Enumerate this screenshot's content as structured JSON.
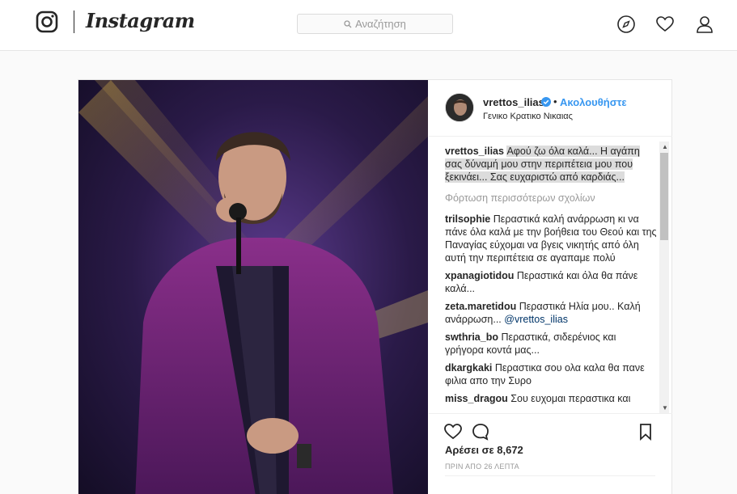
{
  "header": {
    "wordmark": "Instagram",
    "search_placeholder": "Αναζήτηση",
    "icons": [
      "instagram-logo-icon",
      "search-icon",
      "explore-compass-icon",
      "heart-icon",
      "profile-icon"
    ]
  },
  "post": {
    "username": "vrettos_ilias",
    "verified": true,
    "follow_label": "Ακολουθήστε",
    "separator": "•",
    "location": "Γενικο Κρατικο Νικαιας",
    "caption": {
      "user": "vrettos_ilias",
      "text": "Αφού ζω όλα καλά... Η αγάπη σας δύναμή μου στην περιπέτεια μου που ξεκινάει... Σας ευχαριστώ από καρδιάς..."
    },
    "load_more": "Φόρτωση περισσότερων σχολίων",
    "comments": [
      {
        "user": "trilsophie",
        "text": "Περαστικά καλή ανάρρωση κι να πάνε όλα καλά με την βοήθεια του Θεού και της Παναγίας εύχομαι να βγεις νικητής από όλη αυτή την περιπέτεια σε αγαπαμε πολύ"
      },
      {
        "user": "xpanagiotidou",
        "text": "Περαστικά και όλα θα πάνε καλά..."
      },
      {
        "user": "zeta.maretidou",
        "text": "Περαστικά Ηλία μου.. Καλή ανάρρωση...",
        "mention": "@vrettos_ilias"
      },
      {
        "user": "swthria_bo",
        "text": "Περαστικά, σιδερένιος και γρήγορα κοντά μας..."
      },
      {
        "user": "dkargkaki",
        "text": "Περαστικα σου ολα καλα θα πανε φιλια απο την Συρο"
      },
      {
        "user": "miss_dragou",
        "text": "Σου ευχομαι περαστικα και"
      }
    ],
    "likes_text": "Αρέσει σε 8,672",
    "time_text": "ΠΡΙΝ ΑΠΟ 26 ΛΕΠΤΑ",
    "colors": {
      "accent": "#3897f0",
      "verified": "#3897f0",
      "highlight": "#dcdcdc"
    }
  }
}
